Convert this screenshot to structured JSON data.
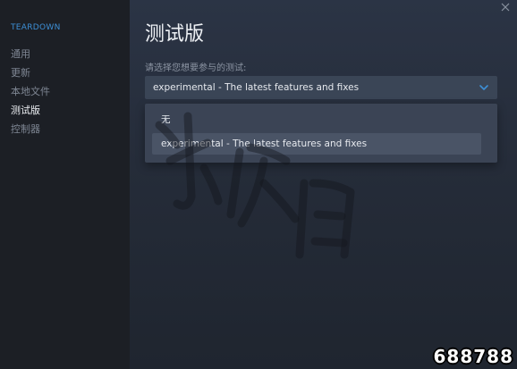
{
  "sidebar": {
    "game_title": "TEARDOWN",
    "items": [
      {
        "label": "通用",
        "active": false
      },
      {
        "label": "更新",
        "active": false
      },
      {
        "label": "本地文件",
        "active": false
      },
      {
        "label": "测试版",
        "active": true
      },
      {
        "label": "控制器",
        "active": false
      }
    ]
  },
  "main": {
    "title": "测试版",
    "prompt": "请选择您想要参与的测试:",
    "select": {
      "value": "experimental - The latest features and fixes",
      "icon": "chevron-down-icon"
    },
    "dropdown_options": [
      {
        "label": "无"
      },
      {
        "label": "experimental - The latest features and fixes",
        "highlighted": true
      }
    ]
  },
  "window": {
    "close_icon": "close-icon"
  },
  "watermark": {
    "text": "游侠网"
  },
  "corner_logo": {
    "text": "688788"
  },
  "colors": {
    "accent": "#3d8fd6",
    "sidebar_bg": "#1c1f25",
    "main_bg": "#2b3445",
    "select_bg": "#3a4556",
    "dropdown_bg": "#3b4455",
    "highlight_bg": "#4a5466",
    "text_primary": "#eef1f5",
    "text_muted": "#7f8794"
  }
}
